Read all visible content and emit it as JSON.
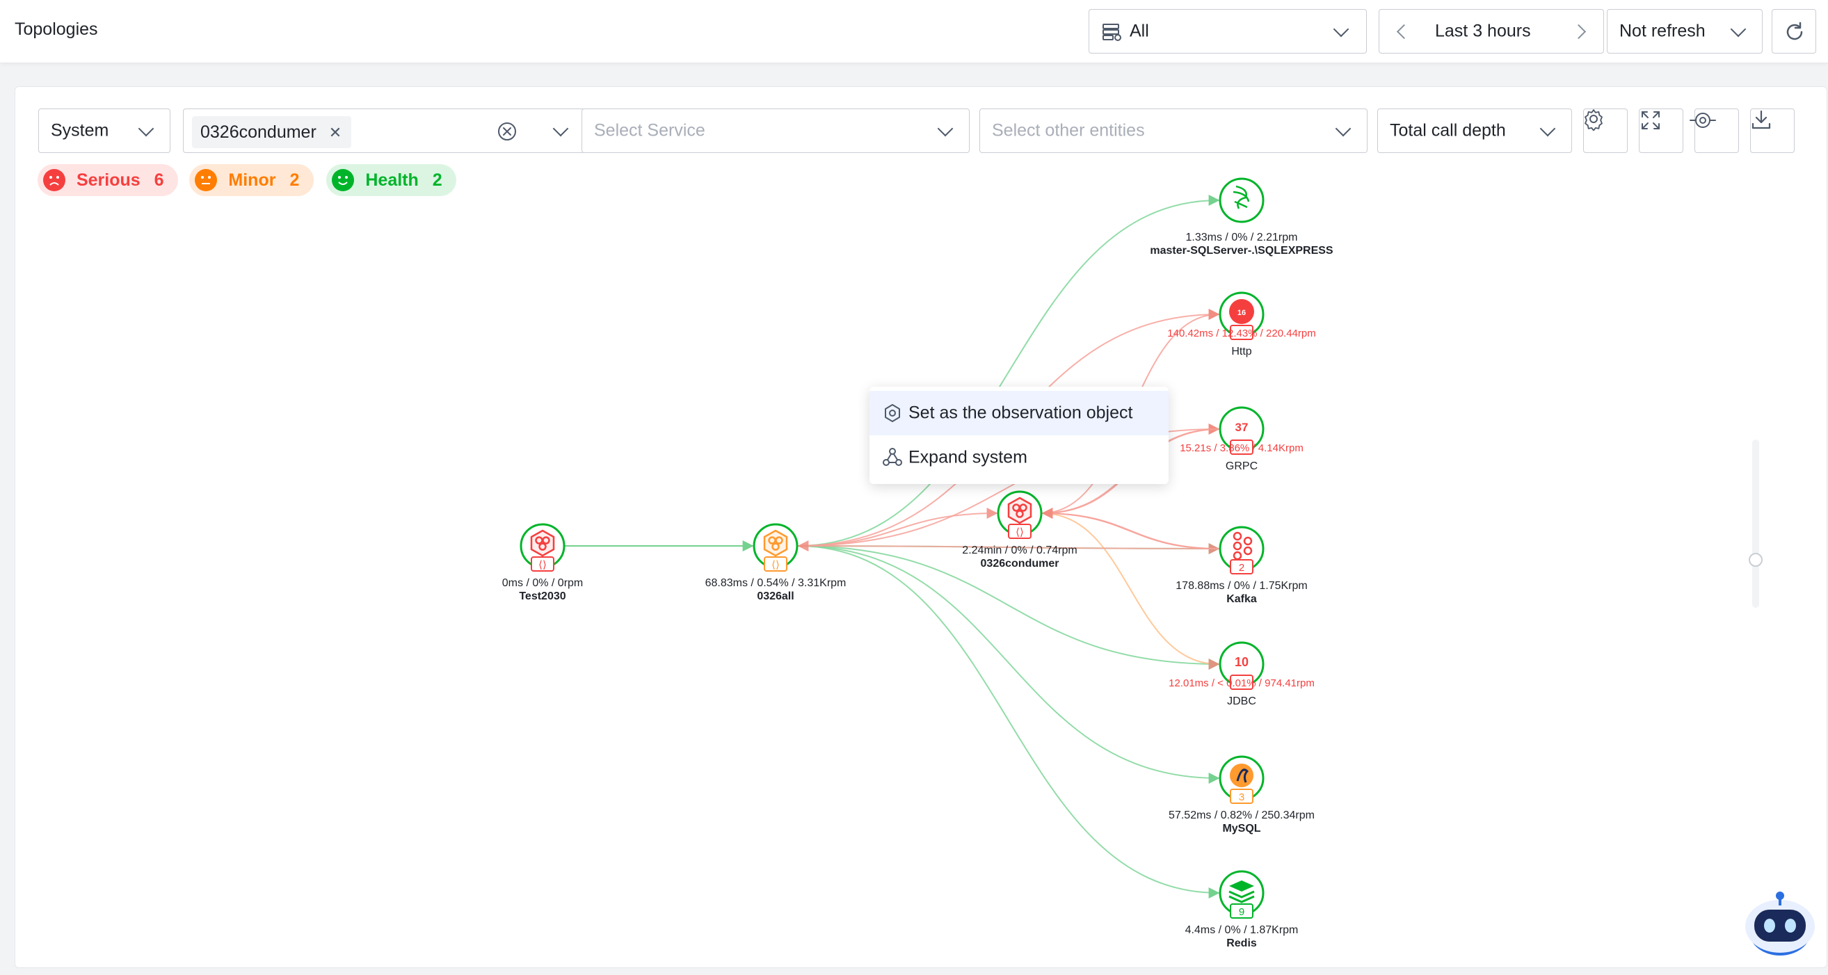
{
  "header": {
    "title": "Topologies",
    "filter_value": "All",
    "time_range": "Last 3 hours",
    "refresh_mode": "Not refresh"
  },
  "toolbar": {
    "scope_select": "System",
    "selected_tag": "0326condumer",
    "service_placeholder": "Select Service",
    "entities_placeholder": "Select other entities",
    "depth_select": "Total call depth"
  },
  "health_summary": [
    {
      "label": "Serious",
      "count": "6",
      "color": "#f53f3f",
      "bg": "#ffe4e4"
    },
    {
      "label": "Minor",
      "count": "2",
      "color": "#ff7d00",
      "bg": "#ffe8d6"
    },
    {
      "label": "Health",
      "count": "2",
      "color": "#00b42a",
      "bg": "#dcf5e3"
    }
  ],
  "context_menu": {
    "items": [
      {
        "label": "Set as the observation object",
        "icon": "target-icon"
      },
      {
        "label": "Expand system",
        "icon": "network-icon"
      }
    ]
  },
  "nodes": [
    {
      "id": "test2030",
      "name": "Test2030",
      "metrics": [
        "0ms",
        "0%",
        "0rpm"
      ],
      "icon": "system-icon",
      "ring": "#00b42a",
      "status": "#f53f3f",
      "badge": "⟨⟩"
    },
    {
      "id": "0326all",
      "name": "0326all",
      "metrics": [
        "68.83ms",
        "0.54%",
        "3.31Krpm"
      ],
      "icon": "system-icon",
      "ring": "#00b42a",
      "status": "#ff9a2e",
      "badge": "⟨⟩"
    },
    {
      "id": "0326condumer",
      "name": "0326condumer",
      "metrics": [
        "2.24min",
        "0%",
        "0.74rpm"
      ],
      "icon": "system-icon",
      "ring": "#00b42a",
      "status": "#f53f3f",
      "badge": "⟨⟩"
    },
    {
      "id": "sqlserver",
      "name": "master-SQLServer-.\\SQLEXPRESS",
      "metrics": [
        "1.33ms",
        "0%",
        "2.21rpm"
      ],
      "icon": "sqlserver-icon",
      "ring": "#00b42a",
      "status": "#00b42a",
      "badge": ""
    },
    {
      "id": "http",
      "name": "Http",
      "metrics": [
        "140.42ms",
        "12.43%",
        "220.44rpm"
      ],
      "icon": "http-icon",
      "ring": "#00b42a",
      "status": "#f53f3f",
      "badge": "16"
    },
    {
      "id": "grpc",
      "name": "GRPC",
      "metrics": [
        "15.21s",
        "3.86%",
        "4.14Krpm"
      ],
      "icon": "grpc-icon",
      "ring": "#00b42a",
      "status": "#f53f3f",
      "badge": "37"
    },
    {
      "id": "kafka",
      "name": "Kafka",
      "metrics": [
        "178.88ms",
        "0%",
        "1.75Krpm"
      ],
      "icon": "kafka-icon",
      "ring": "#00b42a",
      "status": "#f53f3f",
      "badge": "2"
    },
    {
      "id": "jdbc",
      "name": "JDBC",
      "metrics": [
        "12.01ms",
        "< 0.01%",
        "974.41rpm"
      ],
      "icon": "jdbc-icon",
      "ring": "#00b42a",
      "status": "#f53f3f",
      "badge": "10"
    },
    {
      "id": "mysql",
      "name": "MySQL",
      "metrics": [
        "57.52ms",
        "0.82%",
        "250.34rpm"
      ],
      "icon": "mysql-icon",
      "ring": "#00b42a",
      "status": "#ff9a2e",
      "badge": "3"
    },
    {
      "id": "redis",
      "name": "Redis",
      "metrics": [
        "4.4ms",
        "0%",
        "1.87Krpm"
      ],
      "icon": "redis-icon",
      "ring": "#00b42a",
      "status": "#00b42a",
      "badge": "9"
    }
  ],
  "edges": [
    {
      "from": "test2030",
      "to": "0326all",
      "color": "#5cc97b"
    },
    {
      "from": "0326all",
      "to": "sqlserver",
      "color": "#7fd69a"
    },
    {
      "from": "0326all",
      "to": "http",
      "color": "#f7a299"
    },
    {
      "from": "0326all",
      "to": "grpc",
      "color": "#f7a299"
    },
    {
      "from": "0326all",
      "to": "kafka",
      "color": "#7fd69a"
    },
    {
      "from": "0326all",
      "to": "jdbc",
      "color": "#7fd69a"
    },
    {
      "from": "0326all",
      "to": "mysql",
      "color": "#7fd69a"
    },
    {
      "from": "0326all",
      "to": "redis",
      "color": "#7fd69a"
    },
    {
      "from": "0326all",
      "to": "0326condumer",
      "color": "#f7a299"
    },
    {
      "from": "0326condumer",
      "to": "http",
      "color": "#f7a299"
    },
    {
      "from": "0326condumer",
      "to": "grpc",
      "color": "#f7a299"
    },
    {
      "from": "0326condumer",
      "to": "kafka",
      "color": "#f7a299"
    },
    {
      "from": "0326condumer",
      "to": "jdbc",
      "color": "#ffc08a"
    },
    {
      "from": "kafka",
      "to": "0326condumer",
      "color": "#f7a299"
    },
    {
      "from": "grpc",
      "to": "0326condumer",
      "color": "#f7a299"
    },
    {
      "from": "kafka",
      "to": "0326all",
      "color": "#f7a299"
    }
  ]
}
